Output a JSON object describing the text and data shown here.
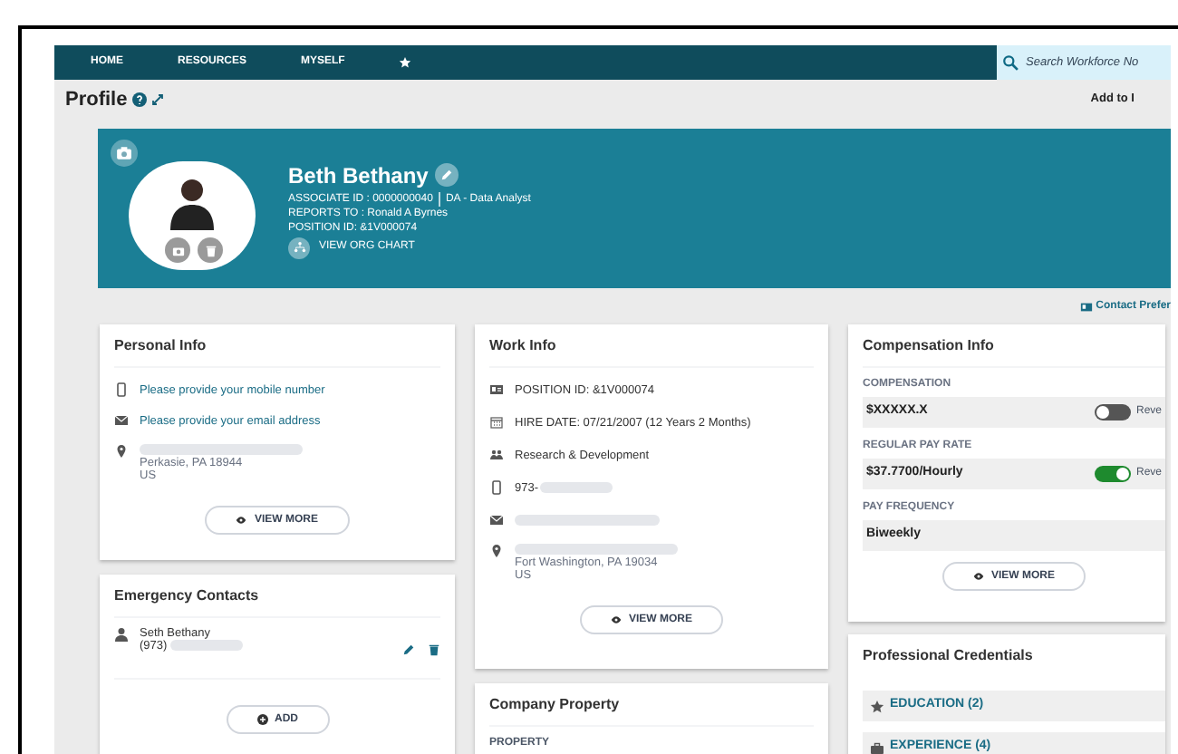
{
  "nav": {
    "items": [
      "HOME",
      "RESOURCES",
      "MYSELF"
    ],
    "search": {
      "placeholder": "Search Workforce No"
    }
  },
  "page": {
    "title": "Profile",
    "add_link": "Add to I"
  },
  "profile": {
    "name": "Beth Bethany",
    "associate_id": "ASSOCIATE ID : 0000000040",
    "role": "DA - Data Analyst",
    "reports_to": "REPORTS TO : Ronald A Byrnes",
    "position_id": "POSITION ID: &1V000074",
    "org_chart": "VIEW ORG CHART"
  },
  "contact_preferences": "Contact Prefer",
  "personal_info": {
    "title": "Personal Info",
    "items": [
      {
        "kind": "phone",
        "text": "Please provide your mobile number"
      },
      {
        "kind": "email",
        "text": "Please provide your email address"
      },
      {
        "kind": "address",
        "lines": [
          "Perkasie, PA 18944",
          "US"
        ]
      }
    ],
    "button": "VIEW MORE"
  },
  "emergency_contacts": {
    "title": "Emergency Contacts",
    "contacts": [
      {
        "name": "Seth Bethany",
        "phone": "(973)"
      }
    ],
    "button": "ADD"
  },
  "work_info": {
    "title": "Work Info",
    "items": [
      {
        "kind": "badge",
        "text": "POSITION ID: &1V000074"
      },
      {
        "kind": "calendar",
        "text": "HIRE DATE: 07/21/2007 (12 Years 2 Months)"
      },
      {
        "kind": "group",
        "text": "Research & Development"
      },
      {
        "kind": "phone",
        "text": "973-"
      },
      {
        "kind": "email"
      },
      {
        "kind": "address",
        "lines": [
          "Fort Washington, PA 19034",
          "US"
        ]
      }
    ],
    "button": "VIEW MORE"
  },
  "company_property": {
    "title": "Company Property",
    "column_1": "PROPERTY"
  },
  "compensation": {
    "title": "Compensation Info",
    "fields": [
      {
        "label": "COMPENSATION",
        "value": "$XXXXX.X",
        "toggle": {
          "on": false,
          "label": "Reve"
        }
      },
      {
        "label": "REGULAR PAY RATE",
        "value": "$37.7700/Hourly",
        "toggle": {
          "on": true,
          "label": "Reve"
        }
      },
      {
        "label": "PAY FREQUENCY",
        "value": "Biweekly"
      }
    ],
    "button": "VIEW MORE"
  },
  "credentials": {
    "title": "Professional Credentials",
    "items": [
      {
        "kind": "star",
        "label": "EDUCATION (2)"
      },
      {
        "kind": "briefcase",
        "label": "EXPERIENCE (4)"
      }
    ]
  }
}
